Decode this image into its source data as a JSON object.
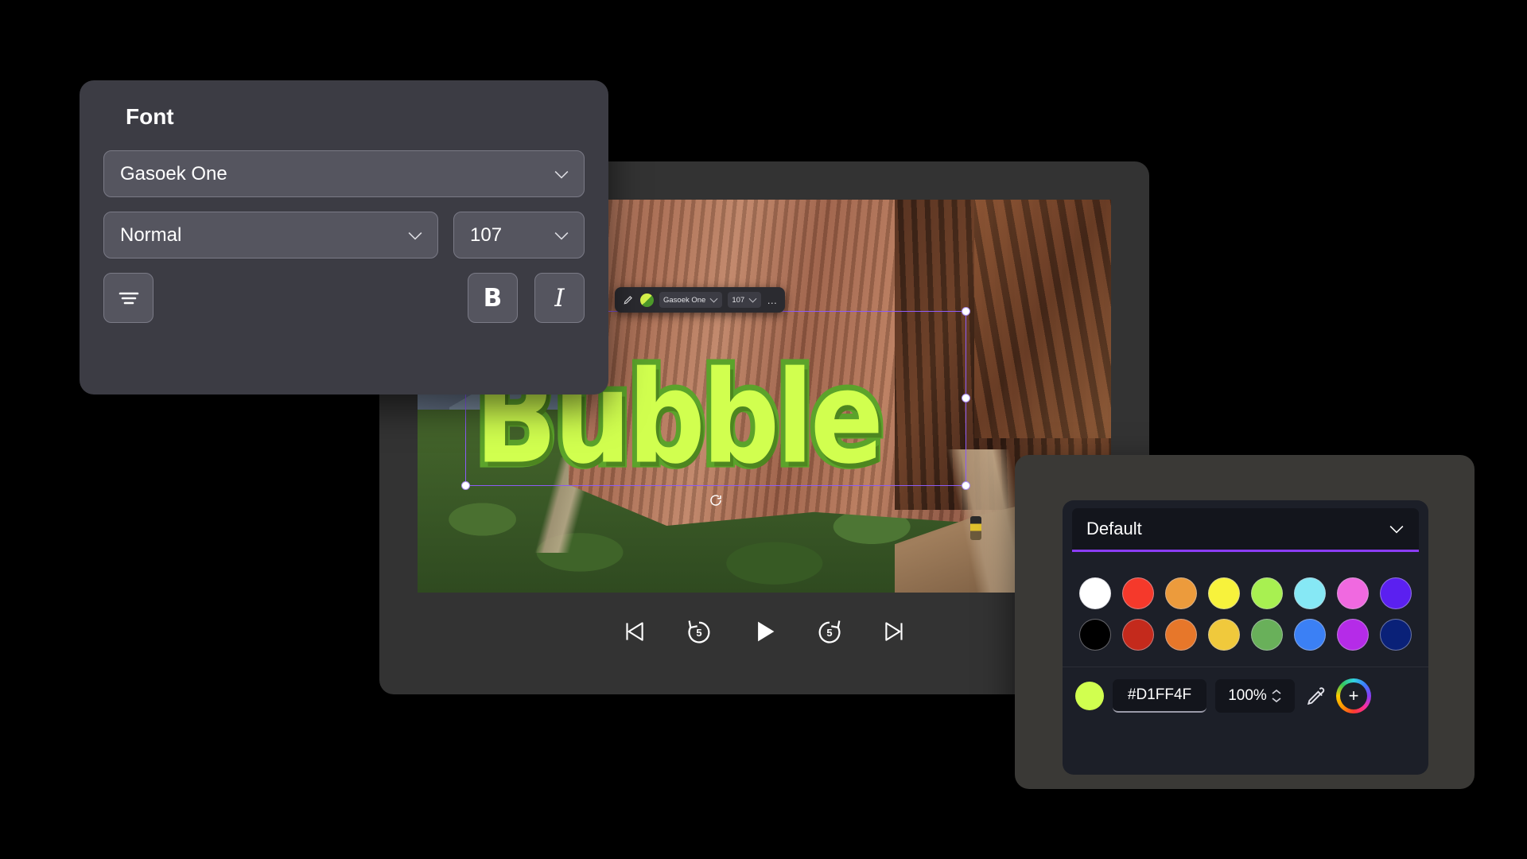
{
  "font_panel": {
    "title": "Font",
    "family": {
      "value": "Gasoek One",
      "icon": "chevron-down-icon"
    },
    "weight": {
      "value": "Normal",
      "icon": "chevron-down-icon"
    },
    "size": {
      "value": "107",
      "icon": "chevron-down-icon"
    },
    "align": {
      "icon": "align-center-icon"
    },
    "bold": {
      "label": "B"
    },
    "italic": {
      "label": "I"
    }
  },
  "canvas": {
    "text_object": "Bubble",
    "text_fill": "#D1FF4F",
    "text_stroke": "#5BA32B",
    "selection_color": "#8B5CF6",
    "rotate_icon": "rotate-icon"
  },
  "mini_toolbar": {
    "edit_icon": "pencil-icon",
    "color_swatch": "text-color-swatch",
    "font_family": "Gasoek One",
    "font_size": "107",
    "more": "…",
    "caret_icon": "chevron-down-icon"
  },
  "playback": {
    "buttons": [
      {
        "name": "skip-to-start-button",
        "icon": "skip-previous-icon",
        "label": ""
      },
      {
        "name": "rewind-5-button",
        "icon": "replay-5-icon",
        "label": "5"
      },
      {
        "name": "play-button",
        "icon": "play-icon",
        "label": ""
      },
      {
        "name": "forward-5-button",
        "icon": "forward-5-icon",
        "label": "5"
      },
      {
        "name": "skip-to-end-button",
        "icon": "skip-next-icon",
        "label": ""
      }
    ]
  },
  "color_picker": {
    "preset_name": "Default",
    "caret_icon": "chevron-down-icon",
    "accent": "#8B3DF6",
    "swatches_row1": [
      {
        "name": "white",
        "hex": "#FFFFFF"
      },
      {
        "name": "red",
        "hex": "#F5392B"
      },
      {
        "name": "orange",
        "hex": "#EC9B3C"
      },
      {
        "name": "yellow",
        "hex": "#F7F23C"
      },
      {
        "name": "lime",
        "hex": "#A8F051"
      },
      {
        "name": "cyan",
        "hex": "#86E8F5"
      },
      {
        "name": "pink",
        "hex": "#F069E0"
      },
      {
        "name": "violet",
        "hex": "#5B20F0"
      }
    ],
    "swatches_row2": [
      {
        "name": "black",
        "hex": "#000000"
      },
      {
        "name": "dark-red",
        "hex": "#C42A1C"
      },
      {
        "name": "dark-orange",
        "hex": "#E7772A"
      },
      {
        "name": "gold",
        "hex": "#F0C93C"
      },
      {
        "name": "green",
        "hex": "#69B05A"
      },
      {
        "name": "blue",
        "hex": "#3B80F5"
      },
      {
        "name": "magenta",
        "hex": "#B52BE8"
      },
      {
        "name": "navy",
        "hex": "#0A2178"
      }
    ],
    "current_color": "#D1FF4F",
    "hex_value": "#D1FF4F",
    "opacity_value": "100%",
    "stepper_icon": "stepper-up-down-icon",
    "eyedropper_icon": "eyedropper-icon",
    "add_icon": "add-color-icon",
    "add_label": "+"
  }
}
